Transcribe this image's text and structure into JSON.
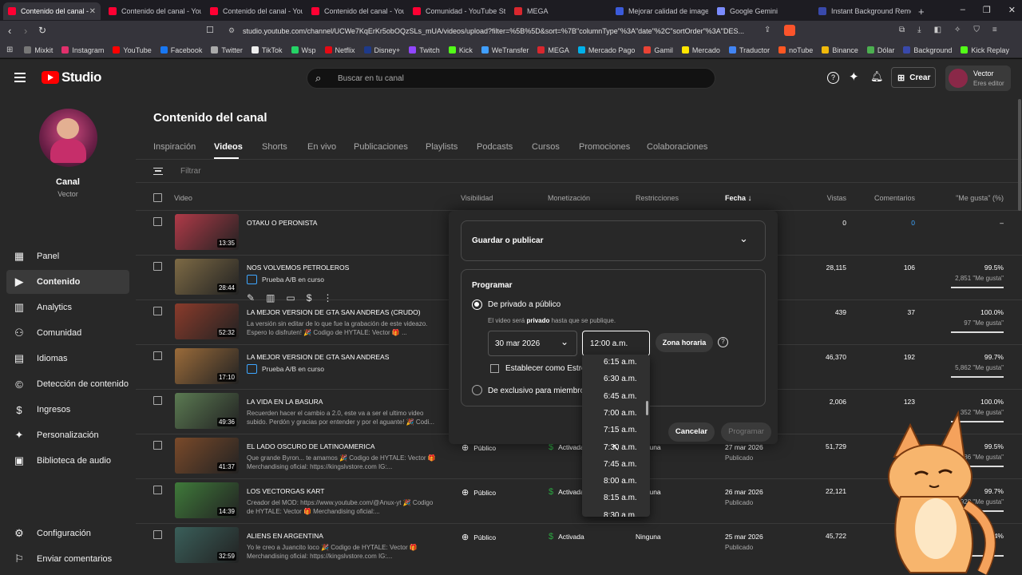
{
  "browser": {
    "tabs": [
      {
        "label": "Contenido del canal -",
        "color": "#ff0033",
        "active": true
      },
      {
        "label": "Contenido del canal - You",
        "color": "#ff0033"
      },
      {
        "label": "Contenido del canal - You",
        "color": "#ff0033"
      },
      {
        "label": "Contenido del canal - You",
        "color": "#ff0033"
      },
      {
        "label": "Comunidad - YouTube Stu",
        "color": "#ff0033"
      },
      {
        "label": "MEGA",
        "color": "#d9272e"
      },
      {
        "label": "Mejorar calidad de imagen",
        "color": "#3b5bdb"
      },
      {
        "label": "Google Gemini",
        "color": "#7b8cff"
      },
      {
        "label": "Instant Background Remo",
        "color": "#3949ab"
      }
    ],
    "new_tab": "+",
    "url": "studio.youtube.com/channel/UCWe7KqErKr5obOQzSLs_mUA/videos/upload?filter=%5B%5D&sort=%7B\"columnType\"%3A\"date\"%2C\"sortOrder\"%3A\"DES...",
    "bookmarks": [
      {
        "label": "Mixkit",
        "color": "#777"
      },
      {
        "label": "Instagram",
        "color": "#e1306c"
      },
      {
        "label": "YouTube",
        "color": "#ff0000"
      },
      {
        "label": "Facebook",
        "color": "#1877f2"
      },
      {
        "label": "Twitter",
        "color": "#aaaaaa"
      },
      {
        "label": "TikTok",
        "color": "#eeeeee"
      },
      {
        "label": "Wsp",
        "color": "#25d366"
      },
      {
        "label": "Netflix",
        "color": "#e50914"
      },
      {
        "label": "Disney+",
        "color": "#1e3a8a"
      },
      {
        "label": "Twitch",
        "color": "#9146ff"
      },
      {
        "label": "Kick",
        "color": "#53fc18"
      },
      {
        "label": "WeTransfer",
        "color": "#409fff"
      },
      {
        "label": "MEGA",
        "color": "#d9272e"
      },
      {
        "label": "Mercado Pago",
        "color": "#00b1ea"
      },
      {
        "label": "Gamil",
        "color": "#ea4335"
      },
      {
        "label": "Mercado",
        "color": "#ffe600"
      },
      {
        "label": "Traductor",
        "color": "#4285f4"
      },
      {
        "label": "noTube",
        "color": "#ff5722"
      },
      {
        "label": "Binance",
        "color": "#f0b90b"
      },
      {
        "label": "Dólar",
        "color": "#4caf50"
      },
      {
        "label": "Background",
        "color": "#3949ab"
      },
      {
        "label": "Kick Replay",
        "color": "#53fc18"
      }
    ]
  },
  "header": {
    "logo_text": "Studio",
    "search_placeholder": "Buscar en tu canal",
    "create_label": "Crear",
    "user_name": "Vector",
    "user_role": "Eres editor"
  },
  "sidebar": {
    "channel_label": "Canal",
    "channel_name": "Vector",
    "items": [
      {
        "label": "Panel",
        "icon": "dashboard-icon",
        "glyph": "▦"
      },
      {
        "label": "Contenido",
        "icon": "content-icon",
        "glyph": "▶",
        "selected": true
      },
      {
        "label": "Analytics",
        "icon": "analytics-icon",
        "glyph": "▥"
      },
      {
        "label": "Comunidad",
        "icon": "community-icon",
        "glyph": "⚇"
      },
      {
        "label": "Idiomas",
        "icon": "subtitles-icon",
        "glyph": "▤"
      },
      {
        "label": "Detección de contenido",
        "icon": "copyright-icon",
        "glyph": "©"
      },
      {
        "label": "Ingresos",
        "icon": "earn-icon",
        "glyph": "$"
      },
      {
        "label": "Personalización",
        "icon": "customize-icon",
        "glyph": "✦"
      },
      {
        "label": "Biblioteca de audio",
        "icon": "audio-library-icon",
        "glyph": "▣"
      }
    ],
    "settings_label": "Configuración",
    "feedback_label": "Enviar comentarios"
  },
  "page": {
    "title": "Contenido del canal",
    "tabs": [
      "Inspiración",
      "Videos",
      "Shorts",
      "En vivo",
      "Publicaciones",
      "Playlists",
      "Podcasts",
      "Cursos",
      "Promociones",
      "Colaboraciones"
    ],
    "active_tab": "Videos",
    "filter_placeholder": "Filtrar",
    "columns": {
      "video": "Video",
      "visibility": "Visibilidad",
      "monetization": "Monetización",
      "restrictions": "Restricciones",
      "date": "Fecha",
      "views": "Vistas",
      "comments": "Comentarios",
      "likes": "\"Me gusta\" (%)"
    }
  },
  "videos": [
    {
      "title": "OTAKU O PERONISTA",
      "duration": "13:35",
      "desc": "",
      "views": "0",
      "comments": "0",
      "likes": "–",
      "likes_sub": "",
      "like_ratio": 0,
      "thumb": "#b03a48"
    },
    {
      "title": "NOS VOLVEMOS PETROLEROS",
      "duration": "28:44",
      "desc": "",
      "badge": "Prueba A/B en curso",
      "views": "28,115",
      "comments": "106",
      "likes": "99.5%",
      "likes_sub": "2,851 \"Me gusta\"",
      "like_ratio": 0.995,
      "thumb": "#7d6a45"
    },
    {
      "title": "LA MEJOR VERSION DE GTA SAN ANDREAS (CRUDO)",
      "duration": "52:32",
      "desc": "La versión sin editar de lo que fue la grabación de este videazo. Espero lo disfruten! 🎉 Codigo de HYTALE: Vector 🎁 ...",
      "views": "439",
      "comments": "37",
      "likes": "100.0%",
      "likes_sub": "97 \"Me gusta\"",
      "like_ratio": 1.0,
      "thumb": "#8a3b2b"
    },
    {
      "title": "LA MEJOR VERSION DE GTA SAN ANDREAS",
      "duration": "17:10",
      "desc": "",
      "badge": "Prueba A/B en curso",
      "views": "46,370",
      "comments": "192",
      "likes": "99.7%",
      "likes_sub": "5,862 \"Me gusta\"",
      "like_ratio": 0.997,
      "thumb": "#9a6b3a"
    },
    {
      "title": "LA VIDA EN LA BASURA",
      "duration": "49:36",
      "desc": "Recuerden hacer el cambio a 2.0, este va a ser el ultimo video subido. Perdón y gracias por entender y por el aguante! 🎉 Codi...",
      "views": "2,006",
      "comments": "123",
      "likes": "100.0%",
      "likes_sub": "352 \"Me gusta\"",
      "like_ratio": 1.0,
      "thumb": "#5b7a52"
    },
    {
      "title": "EL LADO OSCURO DE LATINOAMERICA",
      "duration": "41:37",
      "desc": "Que grande Byron... te amamos 🎉 Codigo de HYTALE: Vector 🎁 Merchandising oficial: https://kingslvstore.com IG:...",
      "visibility": "Público",
      "monetization": "Activada",
      "restrictions": "Ninguna",
      "date": "27 mar 2026",
      "status": "Publicado",
      "views": "51,729",
      "comments": "",
      "likes": "99.5%",
      "likes_sub": "4,286 \"Me gusta\"",
      "like_ratio": 0.995,
      "thumb": "#7a4a2a"
    },
    {
      "title": "LOS VECTORGAS KART",
      "duration": "14:39",
      "desc": "Creador del MOD: https://www.youtube.com/@Anux-yt 🎉 Codigo de HYTALE: Vector 🎁 Merchandising oficial:...",
      "visibility": "Público",
      "monetization": "Activada",
      "restrictions": "Ninguna",
      "date": "26 mar 2026",
      "status": "Publicado",
      "views": "22,121",
      "comments": "",
      "likes": "99.7%",
      "likes_sub": "2,928 \"Me gusta\"",
      "like_ratio": 0.997,
      "thumb": "#3f7a3a"
    },
    {
      "title": "ALIENS EN ARGENTINA",
      "duration": "32:59",
      "desc": "Yo le creo a Juancito loco 🎉 Codigo de HYTALE: Vector 🎁 Merchandising oficial: https://kingslvstore.com IG:...",
      "visibility": "Público",
      "monetization": "Activada",
      "restrictions": "Ninguna",
      "date": "25 mar 2026",
      "status": "Publicado",
      "views": "45,722",
      "comments": "",
      "likes": "99.4%",
      "likes_sub": "",
      "like_ratio": 0.994,
      "thumb": "#3a5f5a"
    }
  ],
  "modal": {
    "save_publish_label": "Guardar o publicar",
    "schedule_title": "Programar",
    "private_to_public": "De privado a público",
    "private_note_pre": "El video será ",
    "private_note_bold": "privado",
    "private_note_post": " hasta que se publique.",
    "date_value": "30 mar 2026",
    "time_value": "12:00 a.m.",
    "timezone_label": "Zona horaria",
    "premiere_label": "Establecer como Estreno",
    "exclusive_label": "De exclusivo para miembros",
    "cancel_label": "Cancelar",
    "schedule_button": "Programar"
  },
  "time_options": [
    "6:15 a.m.",
    "6:30 a.m.",
    "6:45 a.m.",
    "7:00 a.m.",
    "7:15 a.m.",
    "7:30 a.m.",
    "7:45 a.m.",
    "8:00 a.m.",
    "8:15 a.m.",
    "8:30 a.m."
  ],
  "colors": {
    "accent": "#3ea6ff",
    "youtube_red": "#ff0000",
    "bg": "#282828"
  }
}
